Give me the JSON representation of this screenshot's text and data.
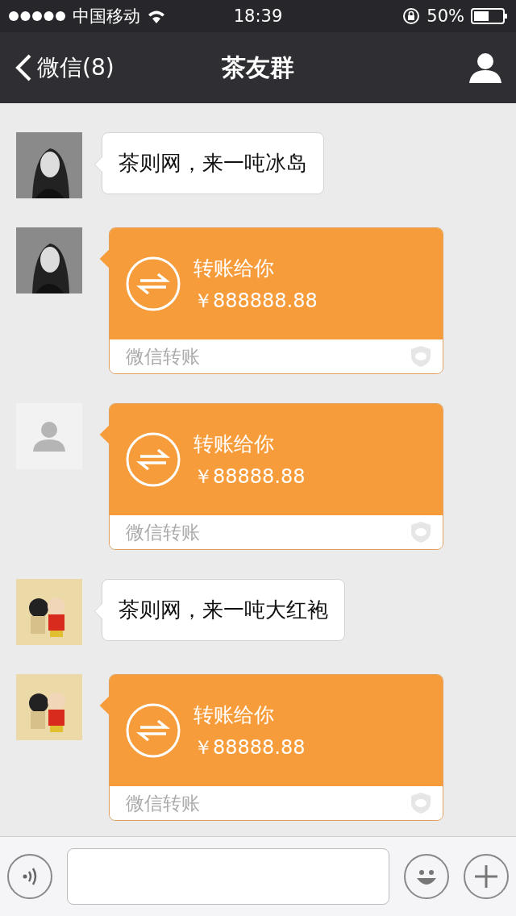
{
  "status_bar": {
    "carrier": "中国移动",
    "time": "18:39",
    "battery": "50%"
  },
  "nav": {
    "back_label": "微信(8)",
    "title": "茶友群"
  },
  "messages": [
    {
      "kind": "text",
      "text": "茶则网，来一吨冰岛"
    },
    {
      "kind": "transfer",
      "title": "转账给你",
      "amount": "￥888888.88",
      "footer": "微信转账"
    },
    {
      "kind": "transfer",
      "avatar": {
        "kind": "placeholder"
      },
      "title": "转账给你",
      "amount": "￥88888.88",
      "footer": "微信转账"
    },
    {
      "kind": "text",
      "text": "茶则网，来一吨大红袍"
    },
    {
      "kind": "transfer",
      "title": "转账给你",
      "amount": "￥88888.88",
      "footer": "微信转账"
    }
  ]
}
